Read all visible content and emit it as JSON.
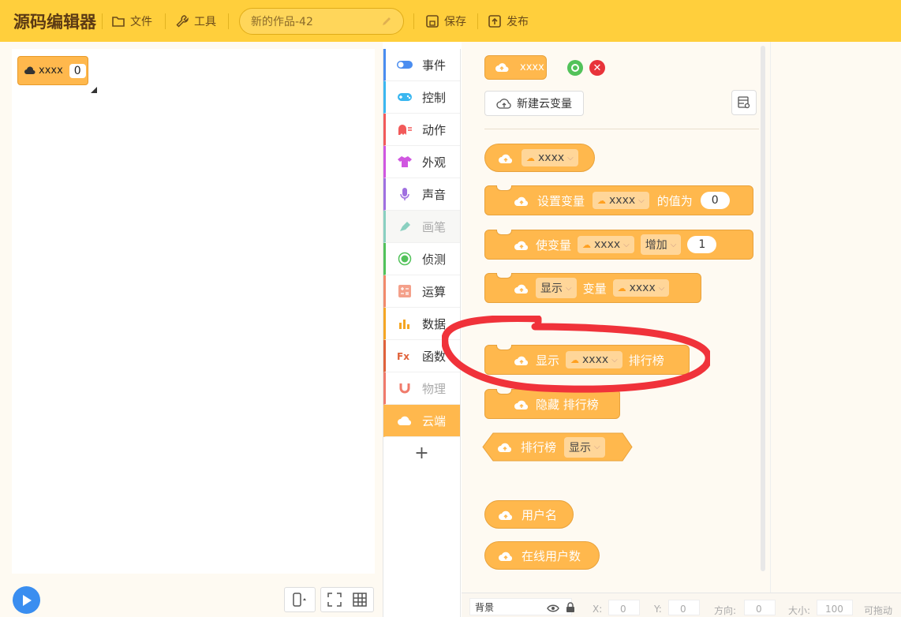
{
  "app": {
    "logo": "源码编辑器"
  },
  "toolbar": {
    "file": "文件",
    "tools": "工具",
    "project_title": "新的作品-42",
    "save": "保存",
    "publish": "发布"
  },
  "stage": {
    "monitor_name": "xxxx",
    "monitor_value": "0"
  },
  "categories": [
    {
      "label": "事件",
      "color": "#4a8df0"
    },
    {
      "label": "控制",
      "color": "#3bb7f0"
    },
    {
      "label": "动作",
      "color": "#f25a5a"
    },
    {
      "label": "外观",
      "color": "#d057e0"
    },
    {
      "label": "声音",
      "color": "#a070e0"
    },
    {
      "label": "画笔",
      "color": "#8ad0c0"
    },
    {
      "label": "侦测",
      "color": "#52c25a"
    },
    {
      "label": "运算",
      "color": "#f28a6a"
    },
    {
      "label": "数据",
      "color": "#f5a623"
    },
    {
      "label": "函数",
      "color": "#e0623a"
    },
    {
      "label": "物理",
      "color": "#f07a6a"
    },
    {
      "label": "云端",
      "color": "#ffb84d"
    }
  ],
  "palette": {
    "var_name": "xxxx",
    "new_cloud_var": "新建云变量",
    "blocks": {
      "set_var": "设置变量",
      "value_is": "的值为",
      "set_value": "0",
      "change_var": "使变量",
      "increase": "增加",
      "change_value": "1",
      "show": "显示",
      "variable": "变量",
      "leaderboard": "排行榜",
      "hide_leaderboard": "隐藏 排行榜",
      "username": "用户名",
      "online_users": "在线用户数"
    }
  },
  "bottombar": {
    "sprite": "背景",
    "x_label": "X:",
    "x": "0",
    "y_label": "Y:",
    "y": "0",
    "dir_label": "方向:",
    "dir": "0",
    "size_label": "大小:",
    "size": "100",
    "drag": "可拖动"
  }
}
